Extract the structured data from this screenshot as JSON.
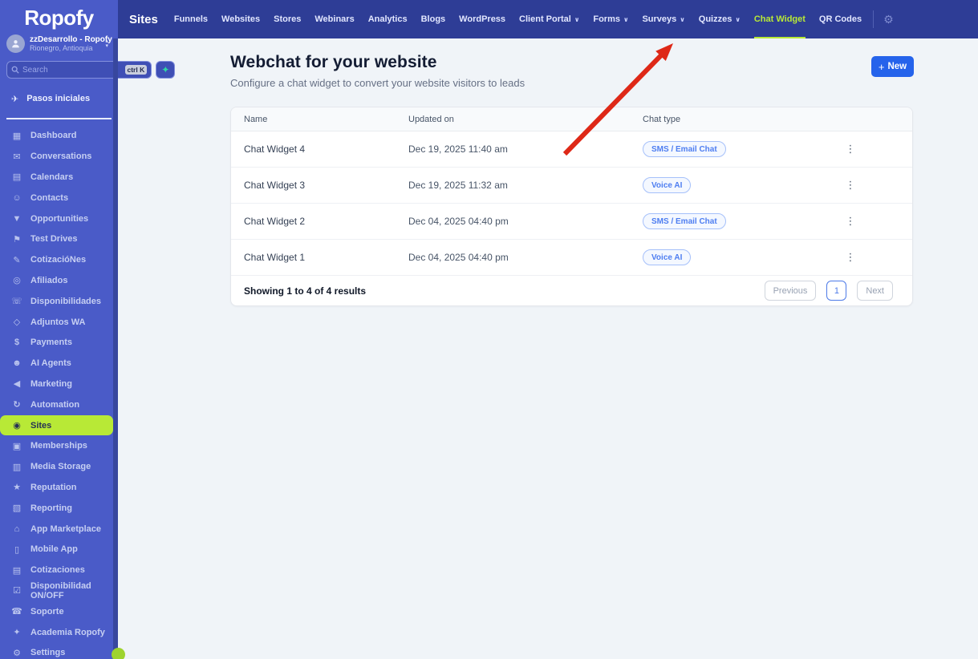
{
  "colors": {
    "sidebar_bg": "#4a5bc8",
    "sidebar_scrollbar": "#38479e",
    "topnav_bg": "#2e3d96",
    "accent_lime": "#b8e936",
    "main_bg": "#f0f4f8",
    "primary_blue": "#2563eb",
    "badge_blue": "#4e7ef1",
    "arrow_red": "#de2817",
    "phone_icon_bg": "#17a56a",
    "rocket_icon_bg": "#2e6bf6",
    "cart_icon_bg": "#35a08b",
    "bell_icon_bg": "#f05a19"
  },
  "icons": {
    "plus": "+",
    "gear": "⚙",
    "kebab": "⋮",
    "chevron_down": "∨",
    "sparkle": "✦",
    "chevron_up_small": "▴",
    "chevron_down_small": "▾"
  },
  "brand": {
    "logo_text": "Ropofy"
  },
  "sidebar": {
    "account": {
      "name": "zzDesarrollo - Ropofy",
      "location": "Rionegro, Antioquia"
    },
    "search": {
      "placeholder": "Search",
      "shortcut": "ctrl K"
    },
    "getting_started": {
      "label": "Pasos iniciales",
      "glyph": "✈"
    },
    "items": [
      {
        "label": "Dashboard",
        "glyph": "▦"
      },
      {
        "label": "Conversations",
        "glyph": "✉"
      },
      {
        "label": "Calendars",
        "glyph": "▤"
      },
      {
        "label": "Contacts",
        "glyph": "☺"
      },
      {
        "label": "Opportunities",
        "glyph": "▼"
      },
      {
        "label": "Test Drives",
        "glyph": "⚑"
      },
      {
        "label": "CotizacióNes",
        "glyph": "✎"
      },
      {
        "label": "Afiliados",
        "glyph": "◎"
      },
      {
        "label": "Disponibilidades",
        "glyph": "☏"
      },
      {
        "label": "Adjuntos WA",
        "glyph": "◇"
      },
      {
        "label": "Payments",
        "glyph": "$"
      },
      {
        "label": "AI Agents",
        "glyph": "☻"
      },
      {
        "label": "Marketing",
        "glyph": "◀"
      },
      {
        "label": "Automation",
        "glyph": "↻"
      },
      {
        "label": "Sites",
        "glyph": "◉"
      },
      {
        "label": "Memberships",
        "glyph": "▣"
      },
      {
        "label": "Media Storage",
        "glyph": "▥"
      },
      {
        "label": "Reputation",
        "glyph": "★"
      },
      {
        "label": "Reporting",
        "glyph": "▧"
      },
      {
        "label": "App Marketplace",
        "glyph": "⌂"
      },
      {
        "label": "Mobile App",
        "glyph": "▯"
      },
      {
        "label": "Cotizaciones",
        "glyph": "▤"
      },
      {
        "label": "Disponibilidad ON/OFF",
        "glyph": "☑"
      },
      {
        "label": "Soporte",
        "glyph": "☎"
      },
      {
        "label": "Academia Ropofy",
        "glyph": "✦"
      },
      {
        "label": "Settings",
        "glyph": "⚙"
      }
    ]
  },
  "topnav": {
    "title": "Sites",
    "tabs": [
      {
        "label": "Funnels"
      },
      {
        "label": "Websites"
      },
      {
        "label": "Stores"
      },
      {
        "label": "Webinars"
      },
      {
        "label": "Analytics"
      },
      {
        "label": "Blogs"
      },
      {
        "label": "WordPress"
      },
      {
        "label": "Client Portal"
      },
      {
        "label": "Forms"
      },
      {
        "label": "Surveys"
      },
      {
        "label": "Quizzes"
      },
      {
        "label": "Chat Widget"
      },
      {
        "label": "QR Codes"
      }
    ]
  },
  "main": {
    "title": "Webchat for your website",
    "subtitle": "Configure a chat widget to convert your website visitors to leads",
    "new_button_label": "New",
    "table": {
      "columns": [
        "Name",
        "Updated on",
        "Chat type"
      ],
      "rows": [
        {
          "name": "Chat Widget 4",
          "updated": "Dec 19, 2025 11:40 am",
          "chat_type": "SMS / Email Chat"
        },
        {
          "name": "Chat Widget 3",
          "updated": "Dec 19, 2025 11:32 am",
          "chat_type": "Voice AI"
        },
        {
          "name": "Chat Widget 2",
          "updated": "Dec 04, 2025 04:40 pm",
          "chat_type": "SMS / Email Chat"
        },
        {
          "name": "Chat Widget 1",
          "updated": "Dec 04, 2025 04:40 pm",
          "chat_type": "Voice AI"
        }
      ],
      "footer": {
        "summary": "Showing 1 to 4 of 4 results",
        "previous_label": "Previous",
        "current_page": "1",
        "next_label": "Next"
      }
    }
  }
}
